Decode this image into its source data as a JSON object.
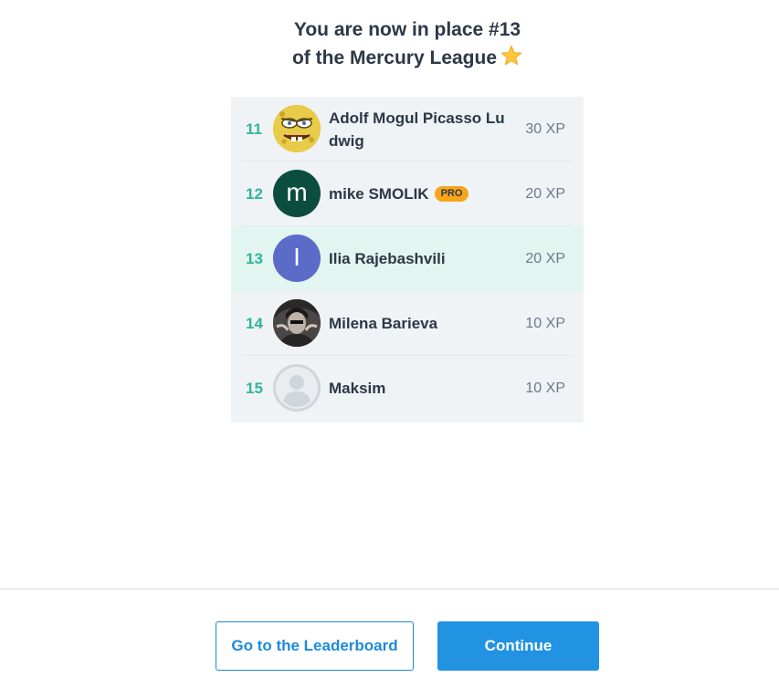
{
  "header": {
    "line1": "You are now in place #13",
    "line2": "of the Mercury League",
    "league_icon": "star-icon"
  },
  "leaderboard": {
    "rows": [
      {
        "rank": "11",
        "name": "Adolf Mogul Picasso Ludwig",
        "xp": "30 XP",
        "avatar": "cartoon-sponge-avatar",
        "pro": false,
        "current": false
      },
      {
        "rank": "12",
        "name": "mike SMOLIK",
        "xp": "20 XP",
        "avatar_letter": "m",
        "avatar_color": "#0b4d3e",
        "pro": true,
        "pro_label": "PRO",
        "current": false
      },
      {
        "rank": "13",
        "name": "Ilia Rajebashvili",
        "xp": "20 XP",
        "avatar_letter": "I",
        "avatar_color": "#5b6bc8",
        "pro": false,
        "current": true
      },
      {
        "rank": "14",
        "name": "Milena Barieva",
        "xp": "10 XP",
        "avatar": "photo-avatar",
        "pro": false,
        "current": false
      },
      {
        "rank": "15",
        "name": "Maksim",
        "xp": "10 XP",
        "avatar": "default-user-avatar",
        "pro": false,
        "current": false
      }
    ],
    "highlight_color": "#e2f5f0",
    "rank_color": "#2fb69a"
  },
  "actions": {
    "leaderboard_label": "Go to the Leaderboard",
    "continue_label": "Continue",
    "accent_color": "#2193e2"
  }
}
